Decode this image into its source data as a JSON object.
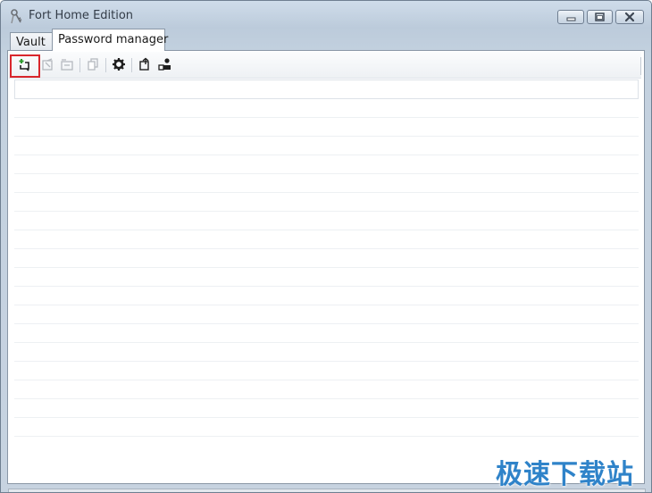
{
  "window": {
    "title": "Fort Home Edition",
    "icon": "key-icon"
  },
  "tabs": [
    {
      "label": "Vault",
      "active": false
    },
    {
      "label": "Password manager",
      "active": true
    }
  ],
  "toolbar": {
    "buttons": [
      {
        "icon": "add-entry-icon",
        "enabled": true,
        "highlighted": true
      },
      {
        "icon": "edit-entry-icon",
        "enabled": false
      },
      {
        "icon": "delete-entry-icon",
        "enabled": false
      },
      {
        "icon": "copy-icon",
        "enabled": false
      },
      {
        "icon": "settings-gear-icon",
        "enabled": true
      },
      {
        "icon": "export-icon",
        "enabled": true
      },
      {
        "icon": "users-icon",
        "enabled": true
      }
    ],
    "highlight_color": "#d9262c"
  },
  "list": {
    "rows": 18
  },
  "watermark": "极速下载站",
  "colors": {
    "titlebar": "#c3d1df",
    "panel": "#ffffff",
    "watermark": "#2f83c9"
  }
}
